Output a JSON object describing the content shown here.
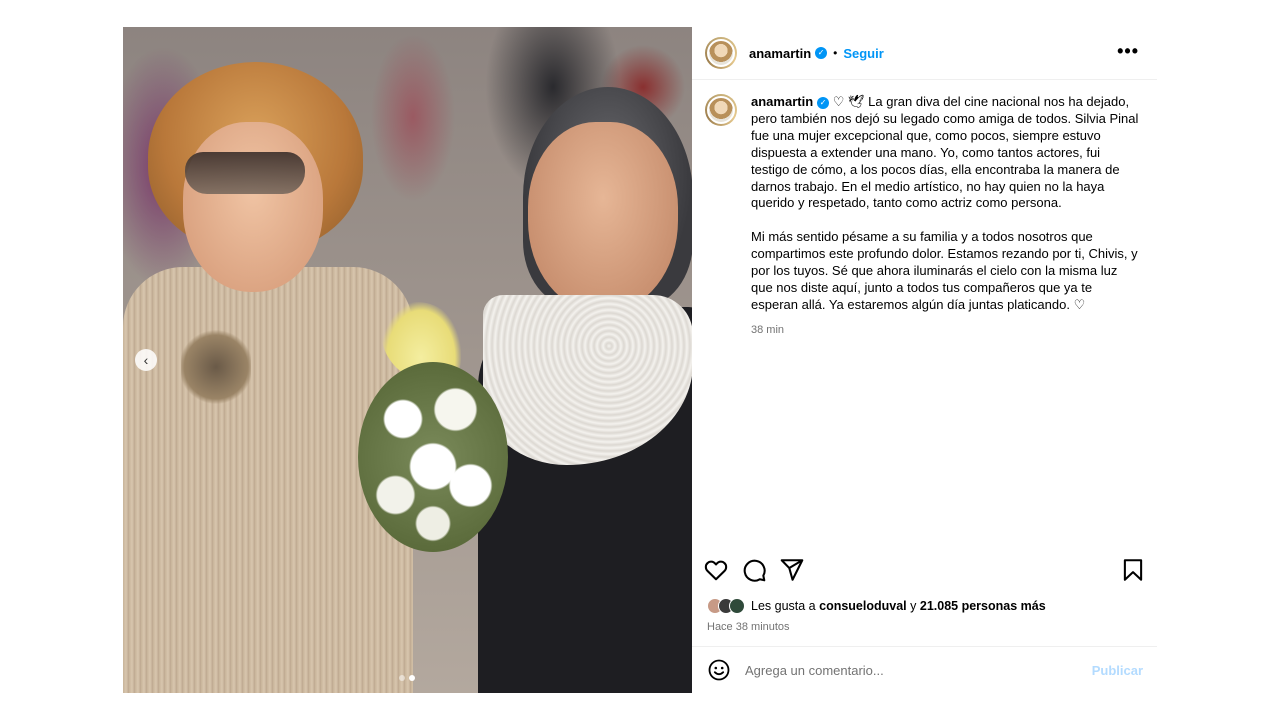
{
  "post": {
    "username": "anamartin",
    "follow_label": "Seguir",
    "more_label": "•••",
    "caption_p1": "♡ 🕊 La gran diva del cine nacional nos ha dejado, pero también nos dejó su legado como amiga de todos. Silvia Pinal fue una mujer excepcional que, como pocos, siempre estuvo dispuesta a extender una mano. Yo, como tantos actores, fui testigo de cómo, a los pocos días, ella encontraba la manera de darnos trabajo. En el medio artístico, no hay quien no la haya querido y respetado, tanto como actriz como persona.",
    "caption_p2": "Mi más sentido pésame a su familia y a todos nosotros que compartimos este profundo dolor. Estamos rezando por ti, Chivis, y por los tuyos. Sé que ahora iluminarás el cielo con la misma luz que nos diste aquí, junto a todos tus compañeros que ya te esperan allá. Ya estaremos algún día juntas platicando. ♡",
    "caption_time": "38 min",
    "likes": {
      "prefix": "Les gusta a",
      "liker": "consueloduval",
      "conj": "y",
      "others": "21.085 personas más"
    },
    "posted_ago": "Hace 38 minutos",
    "comment_placeholder": "Agrega un comentario...",
    "publish_label": "Publicar",
    "carousel": {
      "total_slides": 2,
      "active_slide": 1
    }
  },
  "icons": {
    "like": "heart-icon",
    "comment": "comment-bubble-icon",
    "share": "paper-plane-icon",
    "save": "bookmark-icon",
    "emoji": "smiley-icon",
    "verified": "verified-badge-icon",
    "prev": "chevron-left-icon"
  },
  "colors": {
    "accent": "#0095f6",
    "publish_disabled": "#b3dbff",
    "secondary_text": "#737373",
    "divider": "#efefef"
  }
}
